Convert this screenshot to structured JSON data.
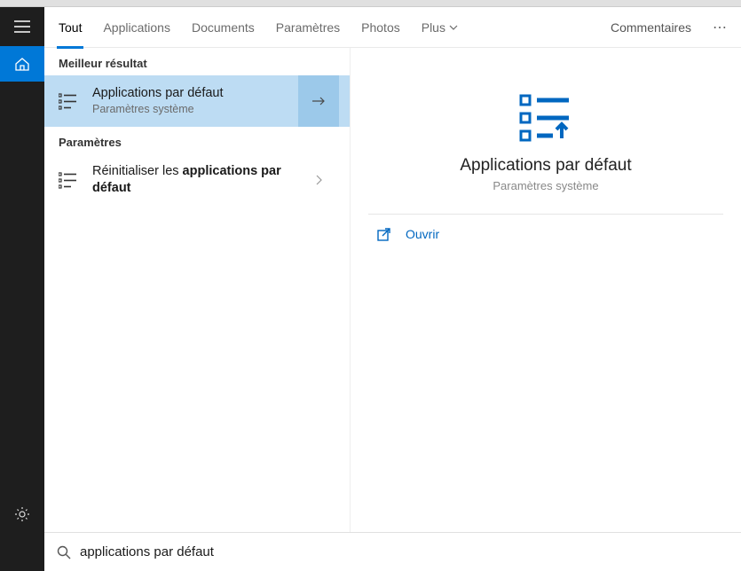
{
  "tabs": {
    "all": "Tout",
    "apps": "Applications",
    "docs": "Documents",
    "settings": "Paramètres",
    "photos": "Photos",
    "more": "Plus",
    "feedback": "Commentaires"
  },
  "sections": {
    "best": "Meilleur résultat",
    "settings": "Paramètres"
  },
  "results": {
    "best": {
      "title": "Applications par défaut",
      "sub": "Paramètres système"
    },
    "settings1": {
      "prefix": "Réinitialiser les ",
      "boldpart": "applications par défaut"
    }
  },
  "detail": {
    "title": "Applications par défaut",
    "sub": "Paramètres système",
    "open": "Ouvrir"
  },
  "search": {
    "value": "applications par défaut"
  }
}
